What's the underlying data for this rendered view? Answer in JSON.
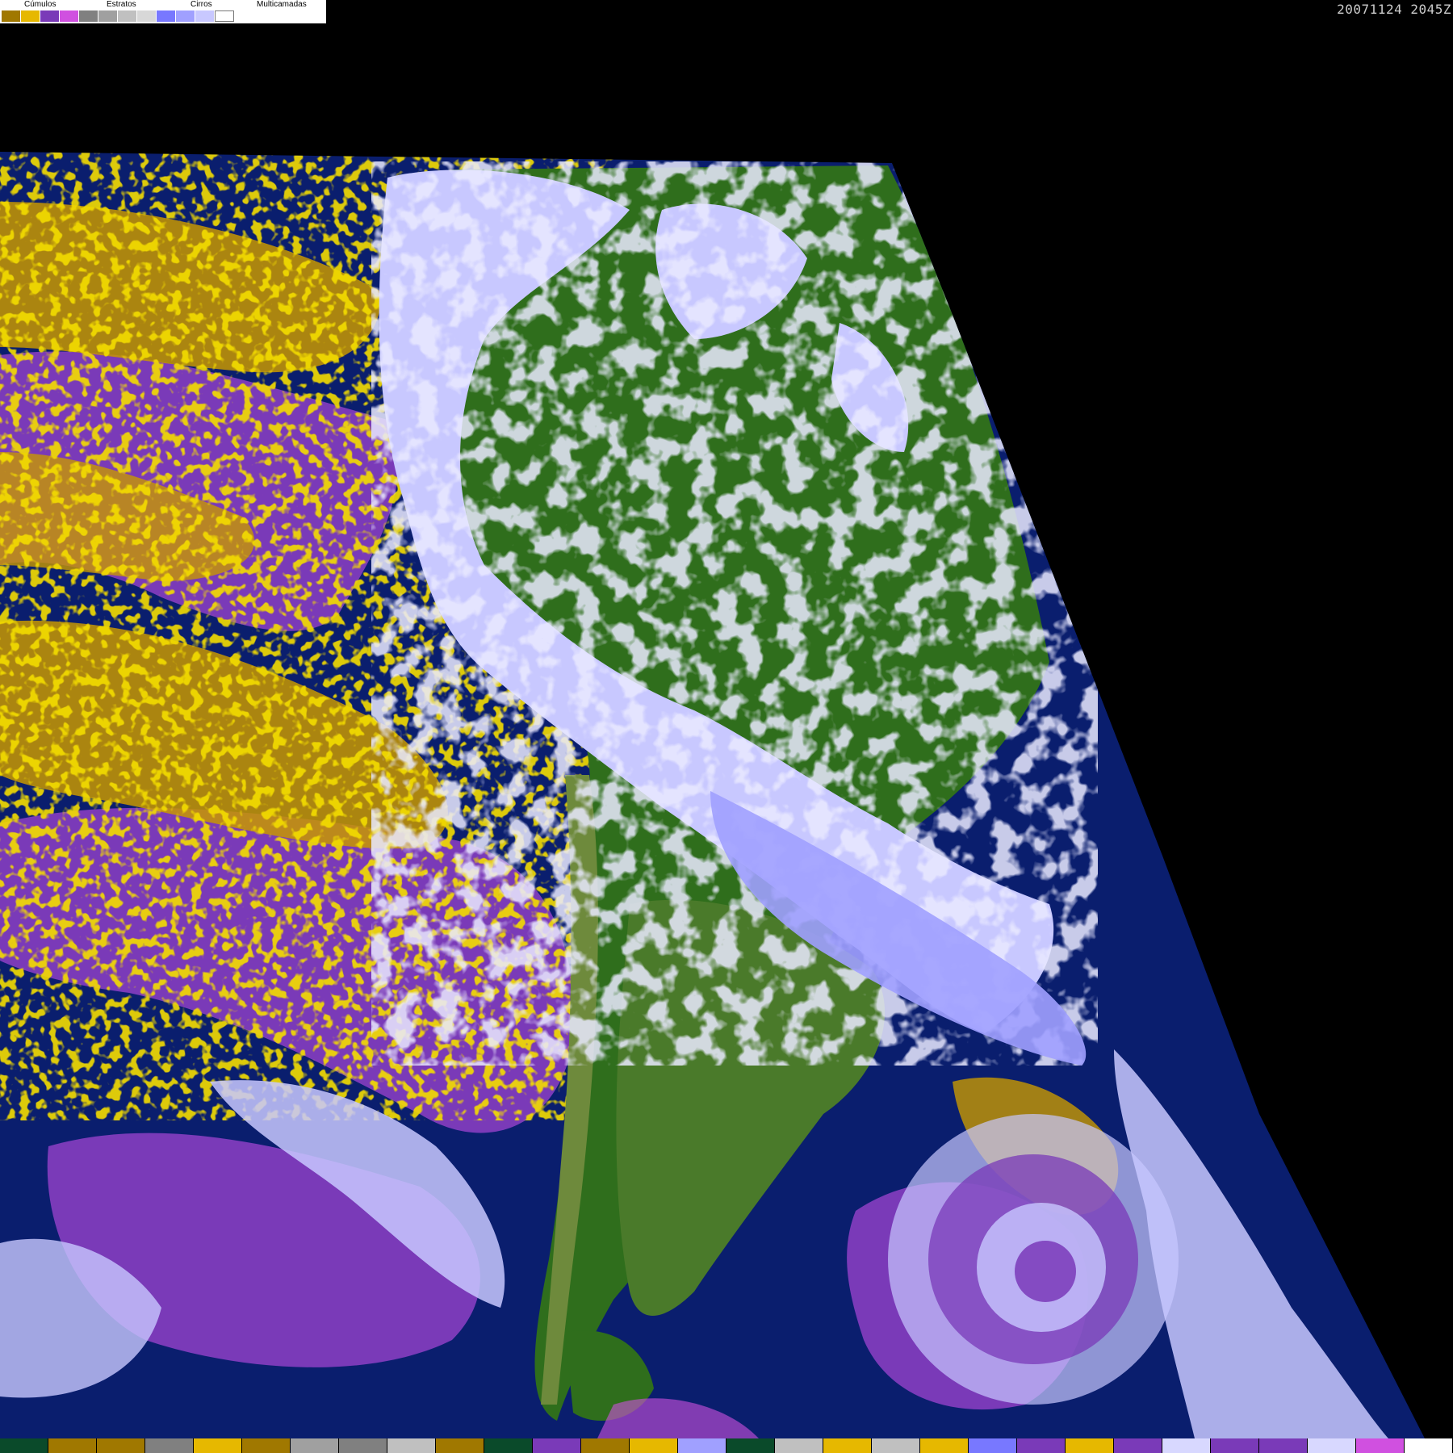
{
  "legend": {
    "categories": [
      {
        "label": "Cúmulos"
      },
      {
        "label": "Estratos"
      },
      {
        "label": "Cirros"
      },
      {
        "label": "Multicamadas"
      }
    ],
    "swatch_colors": [
      "#a07800",
      "#e6b800",
      "#7a3ab8",
      "#d050e0",
      "#808080",
      "#a0a0a0",
      "#c0c0c0",
      "#d8d8d8",
      "#7878ff",
      "#a0a0ff",
      "#c8c8ff",
      "#ffffff"
    ]
  },
  "timestamp": "20071124 2045Z",
  "colors": {
    "ocean": "#0a1e6e",
    "land_forest": "#1e6414",
    "land_dry": "#4a7828",
    "cumulus_dark": "#a07800",
    "cumulus_light": "#e6b800",
    "stratus_dark": "#7a3ab8",
    "stratus_light": "#d050e0",
    "cirrus_gray": "#a0a0a0",
    "multilayer_light": "#c8c8ff",
    "multilayer_mid": "#a0a0ff",
    "background": "#000000"
  },
  "bottom_strip_colors": [
    "#0a4a2a",
    "#a07800",
    "#a07800",
    "#808080",
    "#e6b800",
    "#a07800",
    "#a0a0a0",
    "#808080",
    "#c0c0c0",
    "#a07800",
    "#0a4a2a",
    "#7a3ab8",
    "#a07800",
    "#e6b800",
    "#a0a0ff",
    "#0a4a2a",
    "#c0c0c0",
    "#e6b800",
    "#c0c0c0",
    "#e6b800",
    "#7878ff",
    "#7a3ab8",
    "#e6b800",
    "#7a3ab8",
    "#d8d8ff",
    "#7a3ab8",
    "#7a3ab8",
    "#d8d8ff",
    "#d050e0",
    "#ffffff"
  ]
}
